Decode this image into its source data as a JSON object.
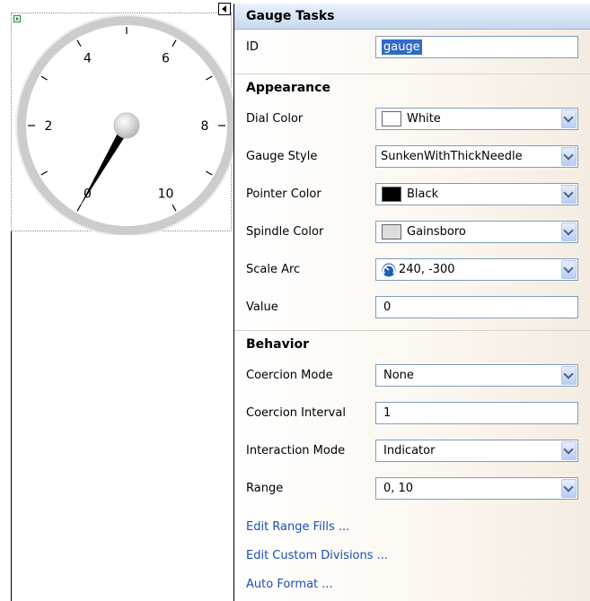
{
  "gauge": {
    "tick_labels": [
      "0",
      "2",
      "4",
      "6",
      "8",
      "10"
    ],
    "value": 0,
    "scale_min": 0,
    "scale_max": 10,
    "needle_color": "#000000",
    "spindle_color": "#dcdcdc",
    "ring_color": "#c8c8c8"
  },
  "panel": {
    "title": "Gauge Tasks",
    "id_label": "ID",
    "id_value": "gauge",
    "sections": {
      "appearance": "Appearance",
      "behavior": "Behavior"
    },
    "dial_color": {
      "label": "Dial Color",
      "value": "White",
      "swatch": "#ffffff"
    },
    "gauge_style": {
      "label": "Gauge Style",
      "value": "SunkenWithThickNeedle"
    },
    "pointer_color": {
      "label": "Pointer Color",
      "value": "Black",
      "swatch": "#000000"
    },
    "spindle_color": {
      "label": "Spindle Color",
      "value": "Gainsboro",
      "swatch": "#dcdcdc"
    },
    "scale_arc": {
      "label": "Scale Arc",
      "value": "240, -300"
    },
    "value_field": {
      "label": "Value",
      "value": "0"
    },
    "coercion_mode": {
      "label": "Coercion Mode",
      "value": "None"
    },
    "coercion_interval": {
      "label": "Coercion Interval",
      "value": "1"
    },
    "interaction_mode": {
      "label": "Interaction Mode",
      "value": "Indicator"
    },
    "range": {
      "label": "Range",
      "value": "0, 10"
    },
    "links": {
      "edit_range_fills": "Edit Range Fills ...",
      "edit_custom_divisions": "Edit Custom Divisions ...",
      "auto_format": "Auto Format ..."
    }
  }
}
